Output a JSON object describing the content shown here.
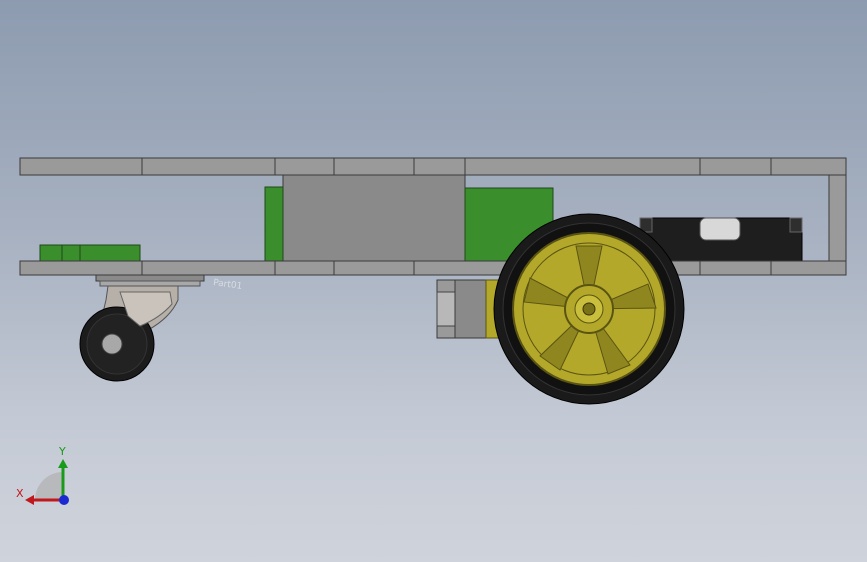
{
  "viewport": {
    "background_top": "#8d9bb0",
    "background_bottom": "#cfd3db"
  },
  "model": {
    "plate_color": "#9a9a9a",
    "plate_edge": "#3a3a3a",
    "standoff_color": "#8a8a8a",
    "pcb_color": "#3a8f2c",
    "tire_color": "#1a1a1a",
    "rim_color": "#b3a82a",
    "battery_color": "#1e1e1e",
    "caster_wheel_color": "#1c1c1c",
    "caster_bracket_color": "#b7b0a8",
    "part_label": "Part01"
  },
  "triad": {
    "x_label": "X",
    "y_label": "Y",
    "x_color": "#c0181c",
    "y_color": "#1a9a1a",
    "z_color": "#1a2ad0",
    "icons": [
      "triad-x-arrow-icon",
      "triad-y-arrow-icon",
      "triad-z-dot-icon"
    ]
  }
}
